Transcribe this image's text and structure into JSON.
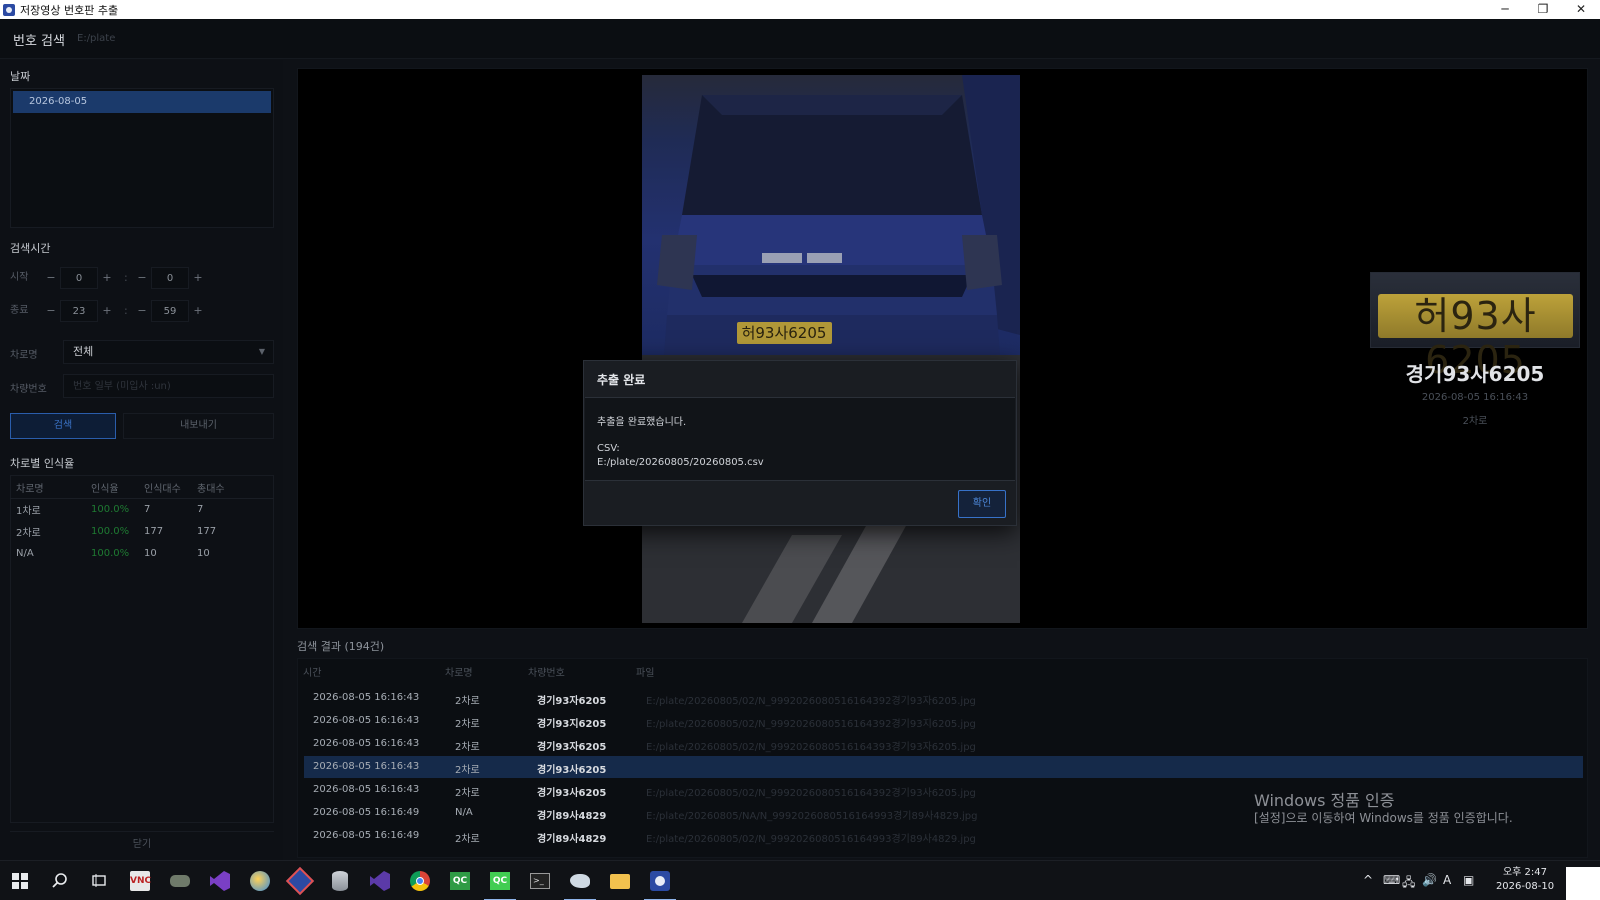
{
  "window": {
    "title": "저장영상 번호판 추출",
    "min": "─",
    "restore": "❐",
    "close": "✕"
  },
  "header": {
    "title": "번호 검색",
    "path": "E:/plate"
  },
  "left": {
    "date_label": "날짜",
    "dates": [
      "2026-08-05"
    ],
    "time_label": "검색시간",
    "start_label": "시작",
    "end_label": "종료",
    "start_hour": "0",
    "start_min": "0",
    "end_hour": "23",
    "end_min": "59",
    "minus": "−",
    "plus": "+",
    "colon": ":",
    "lane_label": "차로명",
    "lane_value": "전체",
    "plate_label": "차량번호",
    "plate_placeholder": "번호 일부 (미입사 :un)",
    "search_button": "검색",
    "export_button": "내보내기",
    "stats_label": "차로별 인식율",
    "stats_headers": [
      "차로명",
      "인식율",
      "인식대수",
      "총대수"
    ],
    "stats_rows": [
      [
        "1차로",
        "100.0%",
        "7",
        "7"
      ],
      [
        "2차로",
        "100.0%",
        "177",
        "177"
      ],
      [
        "N/A",
        "100.0%",
        "10",
        "10"
      ]
    ],
    "close_button": "닫기"
  },
  "preview": {
    "plate_crop_text": "허93사6205",
    "plate_number": "경기93사6205",
    "timestamp": "2026-08-05 16:16:43",
    "lane": "2차로"
  },
  "results": {
    "title": "검색 결과 (194건)",
    "headers": [
      "시간",
      "차로명",
      "차량번호",
      "파일"
    ],
    "rows": [
      [
        "2026-08-05 16:16:43",
        "2차로",
        "경기93자6205",
        "E:/plate/20260805/02/N_9992026080516164392경기93자6205.jpg"
      ],
      [
        "2026-08-05 16:16:43",
        "2차로",
        "경기93지6205",
        "E:/plate/20260805/02/N_9992026080516164392경기93지6205.jpg"
      ],
      [
        "2026-08-05 16:16:43",
        "2차로",
        "경기93자6205",
        "E:/plate/20260805/02/N_9992026080516164393경기93자6205.jpg"
      ],
      [
        "2026-08-05 16:16:43",
        "2차로",
        "경기93사6205",
        ""
      ],
      [
        "2026-08-05 16:16:43",
        "2차로",
        "경기93사6205",
        "E:/plate/20260805/02/N_9992026080516164392경기93사6205.jpg"
      ],
      [
        "2026-08-05 16:16:49",
        "N/A",
        "경기89사4829",
        "E:/plate/20260805/NA/N_9992026080516164993경기89사4829.jpg"
      ],
      [
        "2026-08-05 16:16:49",
        "2차로",
        "경기89사4829",
        "E:/plate/20260805/02/N_9992026080516164993경기89사4829.jpg"
      ]
    ],
    "selected_index": 3
  },
  "modal": {
    "title": "추출 완료",
    "message": "추출을 완료했습니다.",
    "csv_label": "CSV:",
    "csv_path": "E:/plate/20260805/20260805.csv",
    "ok_button": "확인"
  },
  "watermark": {
    "line1": "Windows 정품 인증",
    "line2": "[설정]으로 이동하여 Windows를 정품 인증합니다."
  },
  "taskbar": {
    "ampm_time": "오후 2:47",
    "date": "2026-08-10",
    "ime": "A",
    "up_arrow": "^",
    "apps": [
      "start-icon",
      "search-icon",
      "task-view-icon",
      "vnc-icon",
      "game-icon",
      "visual-studio-icon",
      "globe-icon",
      "tool-icon",
      "database-icon",
      "vs-code-icon",
      "chrome-icon",
      "qt-creator-icon",
      "qt-icon",
      "terminal-icon",
      "bird-icon",
      "folder-icon",
      "plate-app-icon"
    ]
  },
  "colors": {
    "accent": "#3b73c6",
    "selected_row": "#152a4a",
    "rate_green": "#1e7a32"
  }
}
